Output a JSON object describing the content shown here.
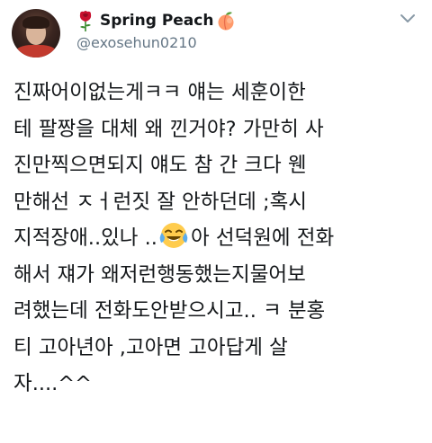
{
  "tweet": {
    "display_name": "Spring Peach",
    "handle": "@exosehun0210",
    "lines": [
      "진짜어이없는게ㅋㅋ 얘는 세훈이한",
      "테 팔짱을 대체 왜 낀거야? 가만히 사",
      "진만찍으면되지 얘도 참 간 크다 웬",
      "만해선 ㅈㅓ런짓 잘 안하던데 ;혹시",
      "지적장애..있나 ..",
      "아 선덕원에 전화",
      "해서 쟤가 왜저런행동했는지물어보",
      "려했는데 전화도안받으시고.. ㅋ 분홍",
      "티 고아년아 ,고아면 고아답게 살",
      "자....^^"
    ]
  },
  "icons": {
    "name_prefix_icon": "rose-icon",
    "name_suffix_icon": "peach-icon",
    "inline_emoji": "tears-of-joy-emoji-icon",
    "menu_icon": "chevron-down-icon"
  },
  "colors": {
    "text_primary": "#14171a",
    "text_secondary": "#657786",
    "background": "#ffffff"
  }
}
